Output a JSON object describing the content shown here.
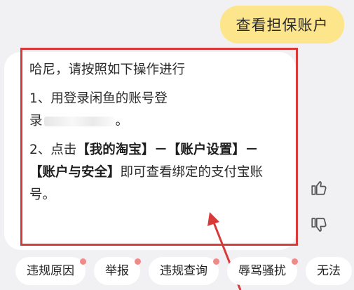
{
  "user_message": "查看担保账户",
  "reply": {
    "greeting": "哈尼，请按照如下操作进行",
    "step1_line1": "1、用登录闲鱼的账号登",
    "step1_line2_start": "录",
    "step1_line2_end": "。",
    "step2_prefix": "2、点击",
    "step2_bold1": "【我的淘宝】－【账户设置】－【账户与安全】",
    "step2_suffix": "即可查看绑定的支付宝账号。"
  },
  "feedback": {
    "like_icon": "thumbs-up-icon",
    "dislike_icon": "thumbs-down-icon"
  },
  "quick_replies": [
    {
      "label": "违规原因",
      "dot": true
    },
    {
      "label": "举报",
      "dot": true
    },
    {
      "label": "违规查询",
      "dot": true
    },
    {
      "label": "辱骂骚扰",
      "dot": true
    },
    {
      "label": "无法",
      "dot": false
    }
  ],
  "colors": {
    "user_bubble": "#fde58c",
    "highlight": "#d83a3a",
    "badge_dot": "#f28989"
  }
}
